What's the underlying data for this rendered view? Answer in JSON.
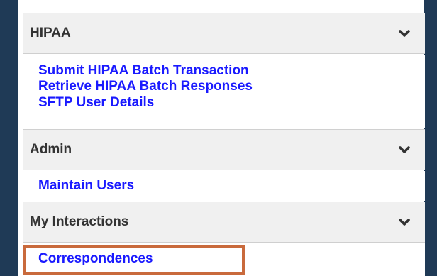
{
  "sections": [
    {
      "title": "HIPAA",
      "links": [
        "Submit HIPAA Batch Transaction",
        "Retrieve HIPAA Batch Responses",
        "SFTP User Details"
      ]
    },
    {
      "title": "Admin",
      "links": [
        "Maintain Users"
      ]
    },
    {
      "title": "My Interactions",
      "links": [
        "Correspondences"
      ]
    }
  ],
  "icons": {
    "expand": "chevron-down-icon"
  },
  "colors": {
    "link": "#1a1aff",
    "header_bg": "#f0f0f0",
    "highlight": "#c96a3c",
    "backdrop": "#1f3a56"
  }
}
